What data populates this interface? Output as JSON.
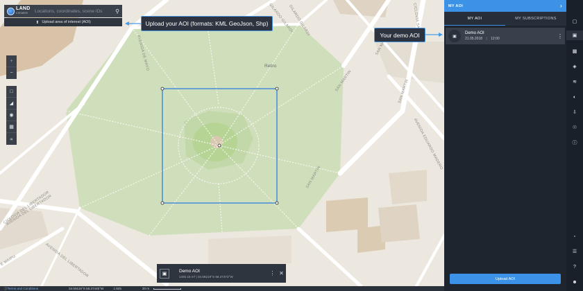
{
  "search": {
    "logo_line1": "LAND",
    "logo_line2": "VIEWER",
    "placeholder": "Locations, coordinates, scene IDs",
    "upload_label": "Upload area of interest (AOI)"
  },
  "callouts": {
    "upload": "Upload your AOI (formats: KML GeoJson, Shp)",
    "demo": "Your demo AOI"
  },
  "map": {
    "place_label": "Retiro",
    "streets": [
      "GILARDO GILARDI",
      "GILARDO GILARDI",
      "AVENIDA DE MAYO",
      "SAN MARTIN",
      "SAN MARTIN",
      "SAN MARTIN",
      "SAN MARTIN",
      "CICLOVIA SANTA FE",
      "AVENIDA EDUARDO MADERO",
      "CICLOVIA DEL LIBERTADOR",
      "AVENIDA DEL LIBERTADOR",
      "AVENIDA DEL LIBERTADOR",
      "AVENIDA DEL LIBERTADOR",
      "E MAIPU"
    ],
    "aoi_color": "#2d7fdc"
  },
  "aoi_bar": {
    "name": "Demo AOI",
    "details": "1492.15 m² | 34.59219°S 58.37373°W"
  },
  "statusbar": {
    "terms": "Terms and Conditions",
    "coords": "34.59119°S 58.37445°W",
    "zoom": "1:925",
    "scale": "30 m"
  },
  "panel": {
    "title": "MY AOI",
    "tabs": [
      "MY AOI",
      "MY SUBSCRIPTIONS"
    ],
    "active_tab": 0,
    "item": {
      "name": "Demo AOI",
      "date": "21.05.2018",
      "time": "12:00"
    },
    "upload_button": "Upload AOI",
    "accent": "#3b92e6"
  },
  "iconbar": [
    "aoi-icon",
    "layers-icon",
    "images-icon",
    "stack-icon",
    "graph-icon",
    "contrast-icon",
    "download-icon",
    "globe-icon",
    "info-icon",
    "chat-icon",
    "cart-icon",
    "help-icon",
    "user-icon"
  ]
}
